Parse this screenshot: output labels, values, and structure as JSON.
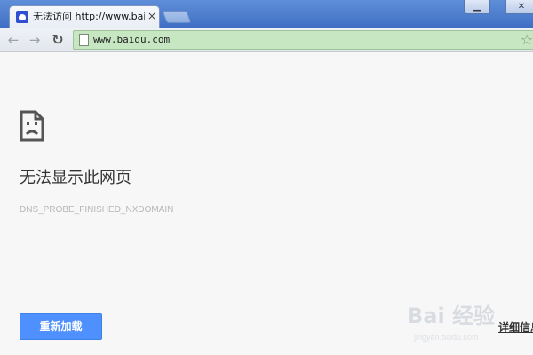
{
  "tab": {
    "title": "无法访问 http://www.bai",
    "close_glyph": "×"
  },
  "window": {
    "min_glyph": "▁",
    "close_glyph": "✕"
  },
  "toolbar": {
    "back_glyph": "←",
    "forward_glyph": "→",
    "reload_glyph": "↻",
    "url": "www.baidu.com",
    "star_glyph": "☆"
  },
  "content": {
    "error_title": "无法显示此网页",
    "error_code": "DNS_PROBE_FINISHED_NXDOMAIN",
    "reload_button_label": "重新加载",
    "details_label": "详细信息"
  },
  "watermark": {
    "logo": "Bai 经验",
    "sub": "jingyan.baidu.com"
  },
  "icons": [
    "favicon-icon",
    "close-icon",
    "back-arrow-icon",
    "forward-arrow-icon",
    "reload-icon",
    "page-icon",
    "star-icon",
    "sad-document-icon"
  ],
  "colors": {
    "accent": "#4d90fe",
    "omnibox": "#c7e6c2",
    "titlebar": "#4f7fcf"
  }
}
